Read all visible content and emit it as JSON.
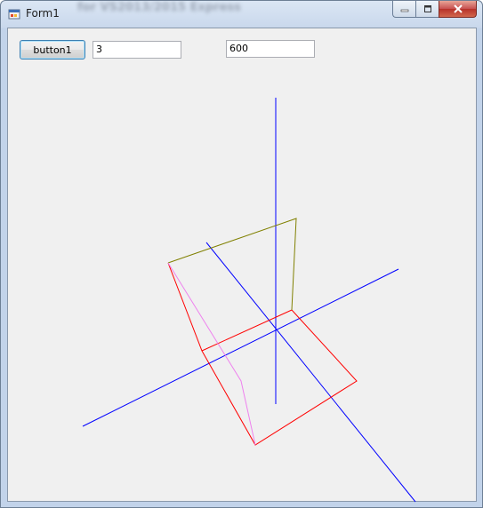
{
  "window": {
    "title": "Form1",
    "background_title_text": "for VS2013/2015 Express"
  },
  "toolbar": {
    "button1_label": "button1",
    "input1_value": "3",
    "input2_value": "600"
  },
  "caption_buttons": {
    "minimize": "minimize-icon",
    "maximize": "maximize-icon",
    "close": "close-icon"
  },
  "colors": {
    "axis": "#0000ff",
    "red_edges": "#ff0000",
    "olive_edges": "#808000",
    "violet_edge": "#ee82ee"
  }
}
